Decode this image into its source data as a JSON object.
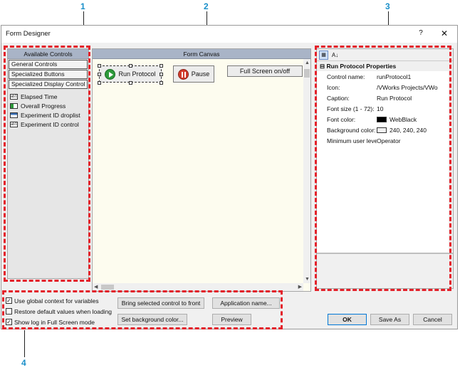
{
  "callouts": [
    "1",
    "2",
    "3",
    "4"
  ],
  "window": {
    "title": "Form Designer",
    "help_glyph": "?",
    "close_glyph": "✕"
  },
  "available": {
    "header": "Available Controls",
    "categories": [
      "General Controls",
      "Specialized Buttons",
      "Specialized Display Control"
    ],
    "items": [
      {
        "label": "Elapsed Time",
        "icon": "text-box-icon",
        "glyph": "abl"
      },
      {
        "label": "Overall Progress",
        "icon": "progress-bar-icon",
        "glyph": ""
      },
      {
        "label": "Experiment ID droplist",
        "icon": "droplist-icon",
        "glyph": ""
      },
      {
        "label": "Experiment ID control",
        "icon": "text-box-icon",
        "glyph": "abl"
      }
    ]
  },
  "canvas": {
    "header": "Form Canvas",
    "run_label": "Run Protocol",
    "pause_label": "Pause",
    "fullscreen_label": "Full Screen on/off"
  },
  "properties": {
    "section_title": "Run Protocol Properties",
    "expand_glyph": "⊟",
    "az_glyph": "A↓",
    "rows": [
      {
        "name": "Control name:",
        "value": "runProtocol1"
      },
      {
        "name": "Icon:",
        "value": "/VWorks Projects/VWo"
      },
      {
        "name": "Caption:",
        "value": "Run Protocol"
      },
      {
        "name": "Font size (1 - 72):",
        "value": "10"
      },
      {
        "name": "Font color:",
        "value": "WebBlack",
        "swatch": "#000000"
      },
      {
        "name": "Background color:",
        "value": "240, 240, 240",
        "swatch": "#f0f0f0"
      },
      {
        "name": "Minimum user level",
        "value": "Operator"
      }
    ]
  },
  "options": {
    "items": [
      {
        "label": "Use global context for variables",
        "checked": true
      },
      {
        "label": "Restore default values when loading",
        "checked": false
      },
      {
        "label": "Show log in Full Screen mode",
        "checked": true
      }
    ],
    "check_glyph": "✓"
  },
  "buttons": {
    "bring_front": "Bring selected control to front",
    "app_name": "Application name...",
    "bg_color": "Set background color...",
    "preview": "Preview",
    "ok": "OK",
    "save_as": "Save As",
    "cancel": "Cancel"
  },
  "colors": {
    "callout": "#1a8fc9",
    "highlight": "#e3212a",
    "panel_header": "#a9b4c7",
    "canvas_bg": "#fdfcef"
  }
}
